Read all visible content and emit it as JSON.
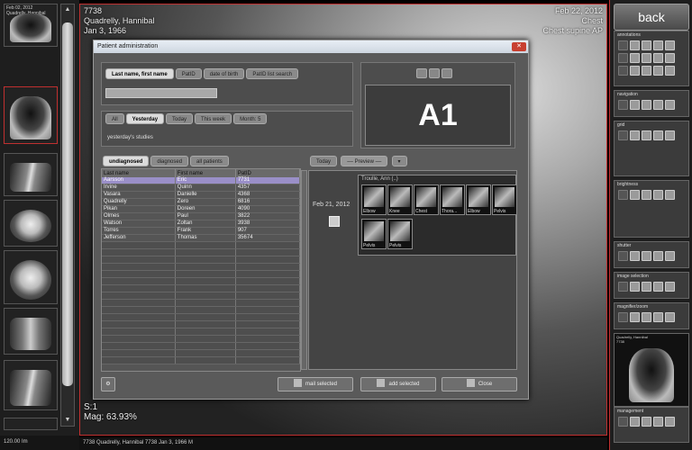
{
  "left_strip": {
    "thumbnails": [
      {
        "caption": "Feb 02, 2012\nQuadrelly, Hannibal",
        "kind": "chest"
      },
      {
        "caption": "",
        "kind": "chest"
      },
      {
        "caption": "",
        "kind": "limb"
      },
      {
        "caption": "",
        "kind": "skull"
      },
      {
        "caption": "",
        "kind": "skull"
      },
      {
        "caption": "",
        "kind": "spine"
      },
      {
        "caption": "",
        "kind": "limb"
      },
      {
        "caption": "",
        "kind": "limb"
      }
    ],
    "footer": "120.00 Im"
  },
  "viewer": {
    "top_left": [
      "7738",
      "Quadrelly, Hannibal",
      "Jan 3, 1966"
    ],
    "top_right": [
      "Feb 22, 2012",
      "Chest",
      "Chest supine AP"
    ],
    "bottom_left": [
      "S:1",
      "Mag: 63.93%"
    ],
    "footer": "7738 Quadrelly, Hannibal 7738 Jan 3, 1966 M"
  },
  "dialog": {
    "title": "Patient administration",
    "name_tabs": [
      "Last name, first name",
      "PatID",
      "date of birth",
      "PatID list search"
    ],
    "name_tab_selected": 0,
    "search_value": "",
    "badge": "A1",
    "date_tabs": [
      "All",
      "Yesterday",
      "Today",
      "This week",
      "Month: 5"
    ],
    "date_tab_selected": 1,
    "date_desc": "yesterday's studies",
    "list_tabs": [
      "undiagnosed",
      "diagnosed",
      "all patients"
    ],
    "list_tab_selected": 0,
    "table": {
      "columns": [
        "Last name",
        "First name",
        "PatID"
      ],
      "rows": [
        [
          "Aarsson",
          "Eric",
          "7731"
        ],
        [
          "Irvine",
          "Quinn",
          "4357"
        ],
        [
          "Vasara",
          "Danielle",
          "4368"
        ],
        [
          "Quadrelly",
          "Zero",
          "6816"
        ],
        [
          "Pikan",
          "Doreen",
          "4090"
        ],
        [
          "Olmes",
          "Paul",
          "3822"
        ],
        [
          "Watson",
          "Zoltan",
          "3938"
        ],
        [
          "Torres",
          "Frank",
          "907"
        ],
        [
          "Jefferson",
          "Thomas",
          "35674"
        ]
      ],
      "highlighted_row": 0,
      "empty_rows": 17
    },
    "preview_controls": {
      "today": "Today",
      "preview": "Preview",
      "toggle": "▾"
    },
    "study": {
      "date": "Feb 21, 2012",
      "series_header": "Troulle, Ann (..)",
      "series": [
        "Elbow",
        "Knee",
        "Chest",
        "Thora...",
        "Elbow",
        "Pelvis",
        "Pelvis",
        "Pelvis"
      ]
    },
    "buttons": {
      "mail": "mail selected",
      "add": "add selected",
      "close": "Close"
    }
  },
  "right_panel": {
    "back": "back",
    "sections": [
      {
        "title": "annotations",
        "rows": 3
      },
      {
        "title": "navigation",
        "rows": 1
      },
      {
        "title": "grid",
        "rows": 1
      },
      {
        "title": "brightness",
        "rows": 1
      },
      {
        "title": "shutter",
        "rows": 1
      },
      {
        "title": "image selection",
        "rows": 1
      },
      {
        "title": "magnifier/zoom",
        "rows": 1
      },
      {
        "title": "management",
        "rows": 1
      }
    ],
    "preview_caption": "Quadrelly, Hannibal\n7738"
  },
  "colors": {
    "accent_red": "#c03030",
    "selected_row": "#9a8fc8"
  }
}
